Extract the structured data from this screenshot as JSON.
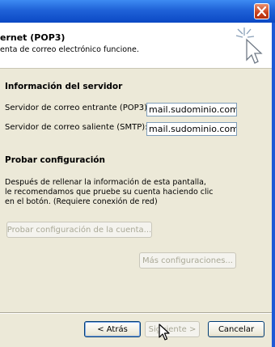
{
  "header": {
    "title": "ernet (POP3)",
    "subtitle": "enta de correo electrónico funcione."
  },
  "server_info": {
    "heading": "Información del servidor",
    "incoming_label": "Servidor de correo entrante (POP3):",
    "incoming_value": "mail.sudominio.com",
    "outgoing_label": "Servidor de correo saliente (SMTP):",
    "outgoing_value": "mail.sudominio.com"
  },
  "test": {
    "heading": "Probar configuración",
    "description": [
      "Después de rellenar la información de esta pantalla,",
      "le recomendamos que pruebe su cuenta haciendo clic",
      "en el botón. (Requiere conexión de red)"
    ],
    "test_button_label": "Probar configuración de la cuenta...",
    "more_settings_label": "Más configuraciones..."
  },
  "footer": {
    "back_label": "< Atrás",
    "next_label": "Siguiente >",
    "cancel_label": "Cancelar"
  },
  "icons": {
    "close": "close-icon",
    "wizard": "cursor-sparkle-icon",
    "mouse": "mouse-pointer-icon"
  },
  "colors": {
    "titlebar": "#0b48c4",
    "close_button": "#c9401b",
    "dialog_bg": "#ece9d8"
  }
}
